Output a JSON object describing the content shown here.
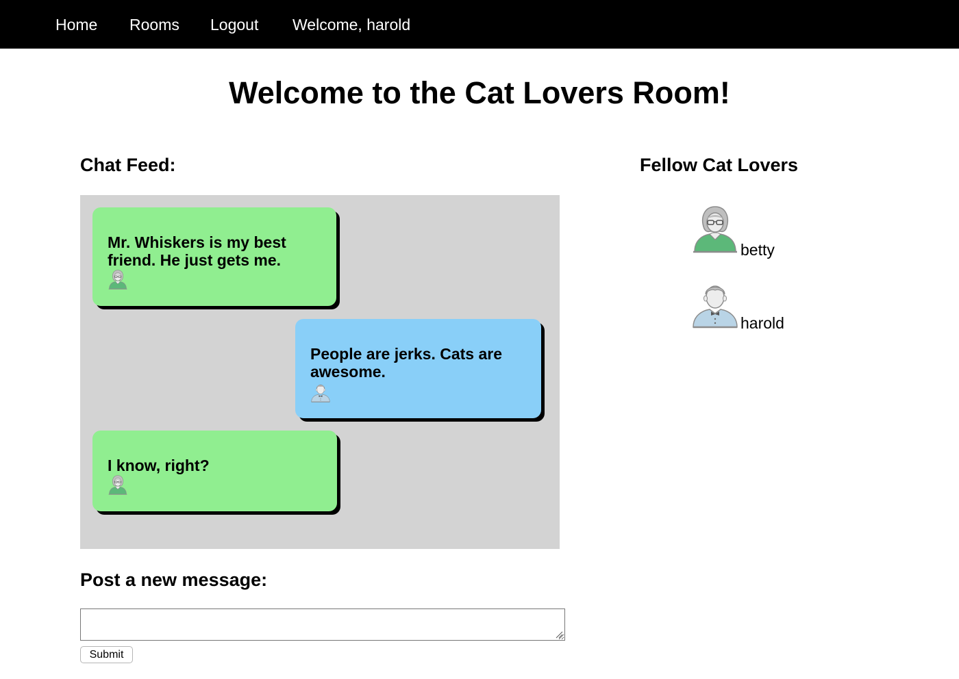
{
  "nav": {
    "home": "Home",
    "rooms": "Rooms",
    "logout": "Logout",
    "welcome": "Welcome, harold"
  },
  "page": {
    "title": "Welcome to the Cat Lovers Room!"
  },
  "chat": {
    "heading": "Chat Feed:",
    "messages": [
      {
        "text": "Mr. Whiskers is my best friend. He just gets me.",
        "author_icon": "female-user-icon",
        "color": "#90ee90"
      },
      {
        "text": "People are jerks. Cats are awesome.",
        "author_icon": "male-user-icon",
        "color": "#89cff8"
      },
      {
        "text": "I know, right?",
        "author_icon": "female-user-icon",
        "color": "#90ee90"
      }
    ]
  },
  "members": {
    "heading": "Fellow Cat Lovers",
    "list": [
      {
        "name": "betty",
        "icon": "female-user-icon"
      },
      {
        "name": "harold",
        "icon": "male-user-icon"
      }
    ]
  },
  "post": {
    "heading": "Post a new message:",
    "placeholder": "",
    "submit_label": "Submit"
  }
}
